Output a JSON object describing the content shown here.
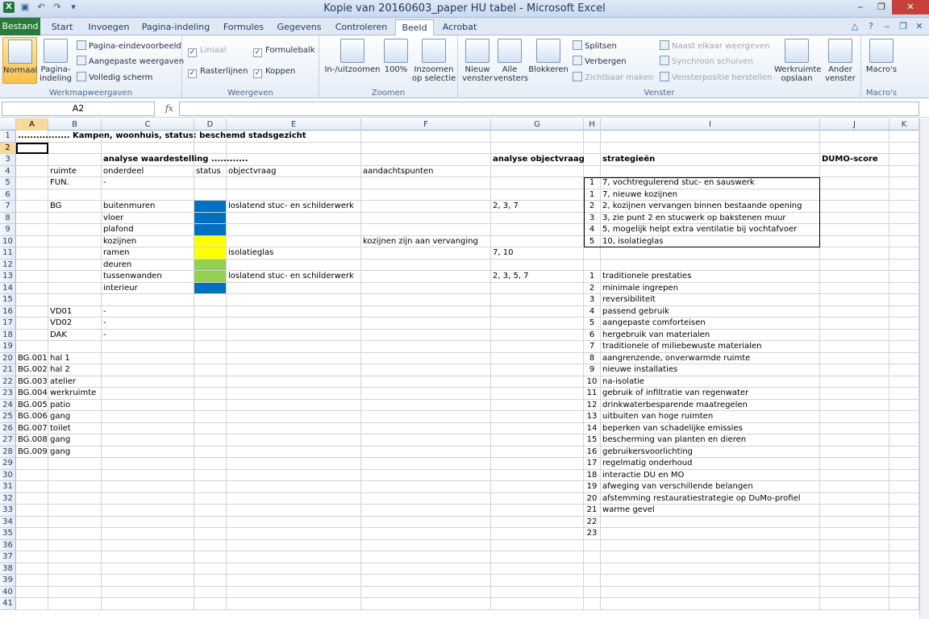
{
  "window": {
    "title": "Kopie van 20160603_paper HU tabel  -  Microsoft Excel"
  },
  "tabs": [
    "Bestand",
    "Start",
    "Invoegen",
    "Pagina-indeling",
    "Formules",
    "Gegevens",
    "Controleren",
    "Beeld",
    "Acrobat"
  ],
  "ribbon": {
    "werkmap": {
      "label": "Werkmapweergaven",
      "normaal": "Normaal",
      "pagina": "Pagina-indeling",
      "paginaeinde": "Pagina-eindevoorbeeld",
      "aangepast": "Aangepaste weergaven",
      "volledig": "Volledig scherm"
    },
    "weergeven": {
      "label": "Weergeven",
      "liniaal": "Liniaal",
      "formulebalk": "Formulebalk",
      "rasterlijnen": "Rasterlijnen",
      "koppen": "Koppen"
    },
    "zoomen": {
      "label": "Zoomen",
      "inuit": "In-/uitzoomen",
      "honderd": "100%",
      "selectie": "Inzoomen op selectie"
    },
    "venster": {
      "label": "Venster",
      "nieuw": "Nieuw venster",
      "alle": "Alle vensters",
      "blokkeren": "Blokkeren",
      "splitsen": "Splitsen",
      "verbergen": "Verbergen",
      "zichtbaar": "Zichtbaar maken",
      "naast": "Naast elkaar weergeven",
      "synchroon": "Synchroon schuiven",
      "positie": "Vensterpositie herstellen",
      "werkruimte": "Werkruimte opslaan",
      "ander": "Ander venster"
    },
    "macros": {
      "label": "Macro's",
      "macros": "Macro's"
    }
  },
  "formula_bar": {
    "name_box": "A2",
    "fx": "fx",
    "formula": ""
  },
  "columns": [
    "A",
    "B",
    "C",
    "D",
    "E",
    "F",
    "G",
    "H",
    "I",
    "J",
    "K"
  ],
  "cells": [
    [
      "A1",
      "................. Kampen, woonhuis, status: beschemd stadsgezicht"
    ],
    [
      "C3",
      "analyse waardestelling ............"
    ],
    [
      "G3",
      "analyse objectvraag"
    ],
    [
      "I3",
      "strategieën"
    ],
    [
      "J3",
      "DUMO-score"
    ],
    [
      "B4",
      "ruimte"
    ],
    [
      "C4",
      "onderdeel"
    ],
    [
      "D4",
      "status"
    ],
    [
      "E4",
      "objectvraag"
    ],
    [
      "F4",
      "aandachtspunten"
    ],
    [
      "B5",
      "FUN."
    ],
    [
      "C5",
      "-"
    ],
    [
      "H5",
      "1"
    ],
    [
      "I5",
      "7, vochtregulerend stuc- en sauswerk"
    ],
    [
      "H6",
      "1"
    ],
    [
      "I6",
      "7, nieuwe kozijnen"
    ],
    [
      "B7",
      "BG"
    ],
    [
      "C7",
      "buitenmuren"
    ],
    [
      "E7",
      "loslatend stuc- en schilderwerk"
    ],
    [
      "G7",
      "2, 3, 7"
    ],
    [
      "H7",
      "2"
    ],
    [
      "I7",
      "2, kozijnen vervangen binnen bestaande opening"
    ],
    [
      "C8",
      "vloer"
    ],
    [
      "H8",
      "3"
    ],
    [
      "I8",
      "3, zie punt 2 en stucwerk op bakstenen muur"
    ],
    [
      "C9",
      "plafond"
    ],
    [
      "H9",
      "4"
    ],
    [
      "I9",
      "5, mogelijk helpt extra ventilatie bij vochtafvoer"
    ],
    [
      "C10",
      "kozijnen"
    ],
    [
      "F10",
      "kozijnen zijn aan vervanging"
    ],
    [
      "H10",
      "5"
    ],
    [
      "I10",
      "10, isolatieglas"
    ],
    [
      "C11",
      "ramen"
    ],
    [
      "E11",
      "isolatieglas"
    ],
    [
      "G11",
      "7, 10"
    ],
    [
      "C12",
      "deuren"
    ],
    [
      "C13",
      "tussenwanden"
    ],
    [
      "E13",
      "loslatend stuc- en schilderwerk"
    ],
    [
      "G13",
      "2, 3, 5, 7"
    ],
    [
      "H13",
      "1"
    ],
    [
      "I13",
      "traditionele prestaties"
    ],
    [
      "C14",
      "interieur"
    ],
    [
      "H14",
      "2"
    ],
    [
      "I14",
      "minimale ingrepen"
    ],
    [
      "H15",
      "3"
    ],
    [
      "I15",
      "reversibiliteit"
    ],
    [
      "B16",
      "VD01"
    ],
    [
      "C16",
      "-"
    ],
    [
      "H16",
      "4"
    ],
    [
      "I16",
      "passend gebruik"
    ],
    [
      "B17",
      "VD02"
    ],
    [
      "C17",
      "-"
    ],
    [
      "H17",
      "5"
    ],
    [
      "I17",
      "aangepaste comforteisen"
    ],
    [
      "B18",
      "DAK"
    ],
    [
      "C18",
      "-"
    ],
    [
      "H18",
      "6"
    ],
    [
      "I18",
      "hergebruik van materialen"
    ],
    [
      "H19",
      "7"
    ],
    [
      "I19",
      "traditionele of miliebewuste materialen"
    ],
    [
      "A20",
      "BG.001"
    ],
    [
      "B20",
      "hal 1"
    ],
    [
      "H20",
      "8"
    ],
    [
      "I20",
      "aangrenzende, onverwarmde ruimte"
    ],
    [
      "A21",
      "BG.002"
    ],
    [
      "B21",
      "hal 2"
    ],
    [
      "H21",
      "9"
    ],
    [
      "I21",
      "nieuwe installaties"
    ],
    [
      "A22",
      "BG.003"
    ],
    [
      "B22",
      "atelier"
    ],
    [
      "H22",
      "10"
    ],
    [
      "I22",
      "na-isolatie"
    ],
    [
      "A23",
      "BG.004"
    ],
    [
      "B23",
      "werkruimte"
    ],
    [
      "H23",
      "11"
    ],
    [
      "I23",
      "gebruik of infiltratie van regenwater"
    ],
    [
      "A24",
      "BG.005"
    ],
    [
      "B24",
      "patio"
    ],
    [
      "H24",
      "12"
    ],
    [
      "I24",
      "drinkwaterbesparende maatregelen"
    ],
    [
      "A25",
      "BG.006"
    ],
    [
      "B25",
      "gang"
    ],
    [
      "H25",
      "13"
    ],
    [
      "I25",
      "uitbuiten van hoge ruimten"
    ],
    [
      "A26",
      "BG.007"
    ],
    [
      "B26",
      "toilet"
    ],
    [
      "H26",
      "14"
    ],
    [
      "I26",
      "beperken van schadelijke emissies"
    ],
    [
      "A27",
      "BG.008"
    ],
    [
      "B27",
      "gang"
    ],
    [
      "H27",
      "15"
    ],
    [
      "I27",
      "bescherming van planten en dieren"
    ],
    [
      "A28",
      "BG.009"
    ],
    [
      "B28",
      "gang"
    ],
    [
      "H28",
      "16"
    ],
    [
      "I28",
      "gebruikersvoorlichting"
    ],
    [
      "H29",
      "17"
    ],
    [
      "I29",
      "regelmatig onderhoud"
    ],
    [
      "H30",
      "18"
    ],
    [
      "I30",
      "interactie DU en MO"
    ],
    [
      "H31",
      "19"
    ],
    [
      "I31",
      "afweging van verschillende belangen"
    ],
    [
      "H32",
      "20"
    ],
    [
      "I32",
      "afstemming restauratiestrategie op DuMo-profiel"
    ],
    [
      "H33",
      "21"
    ],
    [
      "I33",
      "warme gevel"
    ],
    [
      "H34",
      "22"
    ],
    [
      "H35",
      "23"
    ]
  ],
  "status_colors": {
    "D7": "#0070c0",
    "D8": "#0070c0",
    "D9": "#0070c0",
    "D10": "#ffff00",
    "D11": "#ffff00",
    "D12": "#92d050",
    "D13": "#92d050",
    "D14": "#0070c0"
  },
  "row_count": 41,
  "selected_cell": "A2"
}
